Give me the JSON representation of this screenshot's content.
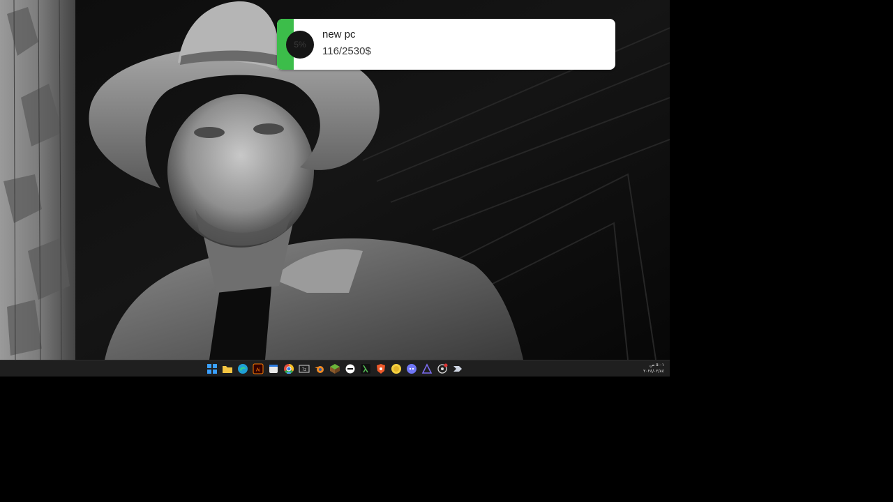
{
  "goal_widget": {
    "progress_label": "5%",
    "progress_value": 0.05,
    "title": "new pc",
    "amount": "116/2530$",
    "accent_color": "#3cbd4a"
  },
  "taskbar": {
    "apps": [
      {
        "name": "start-button",
        "icon": "windows-icon",
        "color": "#3aa0ff"
      },
      {
        "name": "file-explorer",
        "icon": "folder-icon",
        "color": "#f4c542"
      },
      {
        "name": "edge",
        "icon": "edge-icon",
        "color": "#1fa0d6"
      },
      {
        "name": "illustrator",
        "icon": "illustrator-icon",
        "color": "#ff7c00"
      },
      {
        "name": "calendar",
        "icon": "calendar-icon",
        "color": "#e9e9e9"
      },
      {
        "name": "chrome",
        "icon": "chrome-icon",
        "color": "#e24d3d"
      },
      {
        "name": "7zip",
        "icon": "archive-icon",
        "color": "#d0d0d0"
      },
      {
        "name": "blender",
        "icon": "blender-icon",
        "color": "#f08a24"
      },
      {
        "name": "minecraft",
        "icon": "grass-block-icon",
        "color": "#6bb43a"
      },
      {
        "name": "app-dash",
        "icon": "minus-circle-icon",
        "color": "#ffffff"
      },
      {
        "name": "terminal",
        "icon": "lambda-icon",
        "color": "#55c055"
      },
      {
        "name": "brave",
        "icon": "brave-icon",
        "color": "#ef5a2a"
      },
      {
        "name": "coin-app",
        "icon": "coin-icon",
        "color": "#f4d03f"
      },
      {
        "name": "discord",
        "icon": "discord-icon",
        "color": "#6f76f6"
      },
      {
        "name": "affinity",
        "icon": "triangle-icon",
        "color": "#7b6cf0"
      },
      {
        "name": "obs",
        "icon": "record-icon",
        "color": "#d33"
      },
      {
        "name": "steam",
        "icon": "steam-icon",
        "color": "#cfd6e3"
      }
    ]
  },
  "tray": {
    "time": "٥:٠١ ص",
    "date": "٢٠٢٤/٠٢/٨٤"
  }
}
